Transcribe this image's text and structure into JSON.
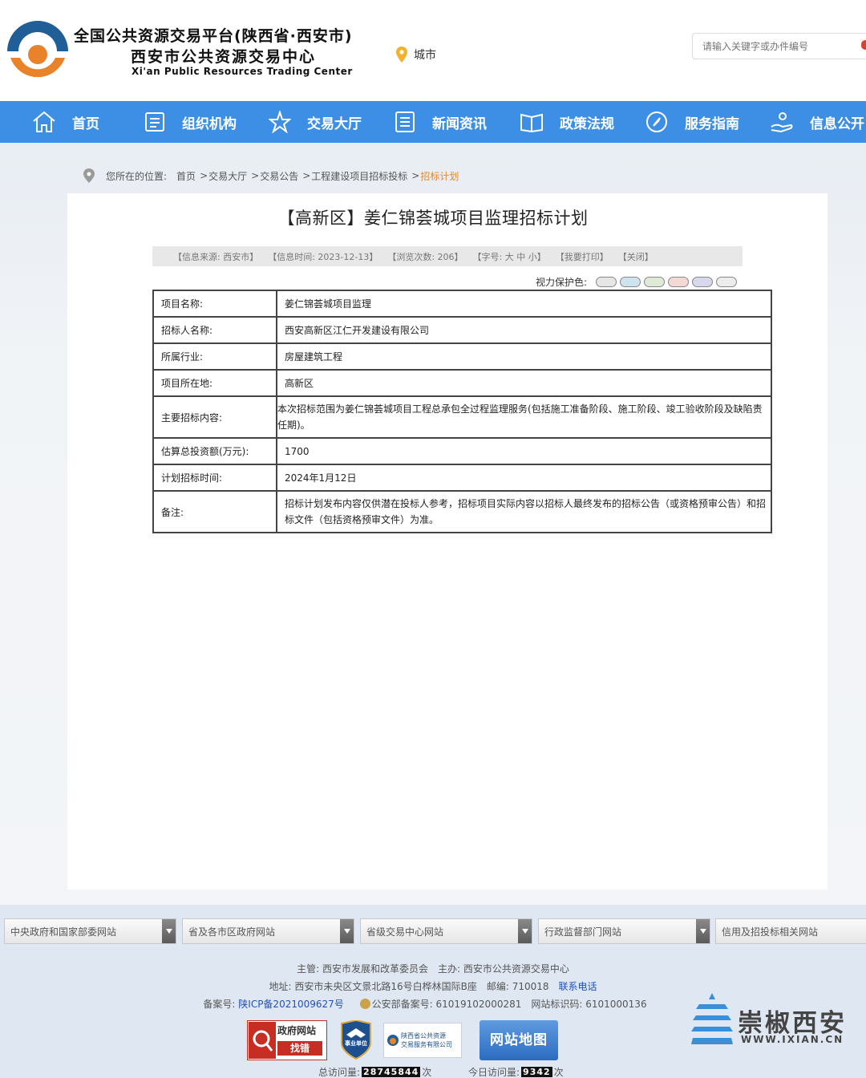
{
  "header": {
    "title_line1": "全国公共资源交易平台(陕西省·西安市)",
    "title_line2": "西安市公共资源交易中心",
    "title_en": "Xi'an Public Resources Trading Center",
    "city_label": "城市",
    "search_placeholder": "请输入关键字或办件编号"
  },
  "nav": {
    "items": [
      {
        "label": "首页",
        "icon": "home-icon"
      },
      {
        "label": "组织机构",
        "icon": "document-icon"
      },
      {
        "label": "交易大厅",
        "icon": "star-icon"
      },
      {
        "label": "新闻资讯",
        "icon": "list-icon"
      },
      {
        "label": "政策法规",
        "icon": "book-icon"
      },
      {
        "label": "服务指南",
        "icon": "compass-icon"
      },
      {
        "label": "信息公开",
        "icon": "hand-icon"
      }
    ]
  },
  "breadcrumb": {
    "prefix": "您所在的位置:",
    "items": [
      "首页",
      "交易大厅",
      "交易公告",
      "工程建设项目招标投标"
    ],
    "current": "招标计划",
    "sep": ">"
  },
  "article": {
    "title": "【高新区】姜仁锦荟城项目监理招标计划",
    "meta": {
      "source": "【信息来源: 西安市】",
      "time": "【信息时间: 2023-12-13】",
      "views": "【浏览次数: 206】",
      "font": "【字号: 大 中 小】",
      "print": "【我要打印】",
      "close": "【关闭】"
    },
    "eye_label": "视力保护色:",
    "eye_colors": [
      "#e6e6e6",
      "#cfe3ee",
      "#dfe9d8",
      "#f3d9d6",
      "#d8d8ec",
      "#ececec"
    ]
  },
  "table": {
    "rows": [
      {
        "key": "项目名称:",
        "value": "姜仁锦荟城项目监理"
      },
      {
        "key": "招标人名称:",
        "value": "西安高新区江仁开发建设有限公司"
      },
      {
        "key": "所属行业:",
        "value": "房屋建筑工程"
      },
      {
        "key": "项目所在地:",
        "value": "高新区"
      },
      {
        "key": "主要招标内容:",
        "value": "本次招标范围为姜仁锦荟城项目工程总承包全过程监理服务(包括施工准备阶段、施工阶段、竣工验收阶段及缺陷责任期)。"
      },
      {
        "key": "估算总投资额(万元):",
        "value": "1700"
      },
      {
        "key": "计划招标时间:",
        "value": "2024年1月12日"
      },
      {
        "key": "备注:",
        "value": "招标计划发布内容仅供潜在投标人参考，招标项目实际内容以招标人最终发布的招标公告（或资格预审公告）和招标文件（包括资格预审文件）为准。"
      }
    ]
  },
  "footer": {
    "links": [
      "中央政府和国家部委网站",
      "省及各市区政府网站",
      "省级交易中心网站",
      "行政监督部门网站",
      "信用及招投标相关网站"
    ],
    "line1": "主管: 西安市发展和改革委员会　主办: 西安市公共资源交易中心",
    "line2_text": "地址: 西安市未央区文景北路16号白桦林国际B座　邮编: 710018　",
    "line2_link": "联系电话",
    "line3_label": "备案号: ",
    "line3_icp": "陕ICP备2021009627号",
    "line3_police": "公安部备案号: 61019102000281　网站标识码: 6101000136",
    "badge1_top": "政府网站",
    "badge1_bottom": "找错",
    "badge2": "事业单位",
    "badge3_line1": "陕西省公共资源",
    "badge3_line2": "交易服务有限公司",
    "badge4": "网站地图",
    "total_label": "总访问量:",
    "total_value": "28745844",
    "today_label": "今日访问量:",
    "today_value": "9342",
    "unit": "次",
    "watermark": "崇椒西安",
    "watermark_url": "WWW.IXIAN.CN"
  }
}
